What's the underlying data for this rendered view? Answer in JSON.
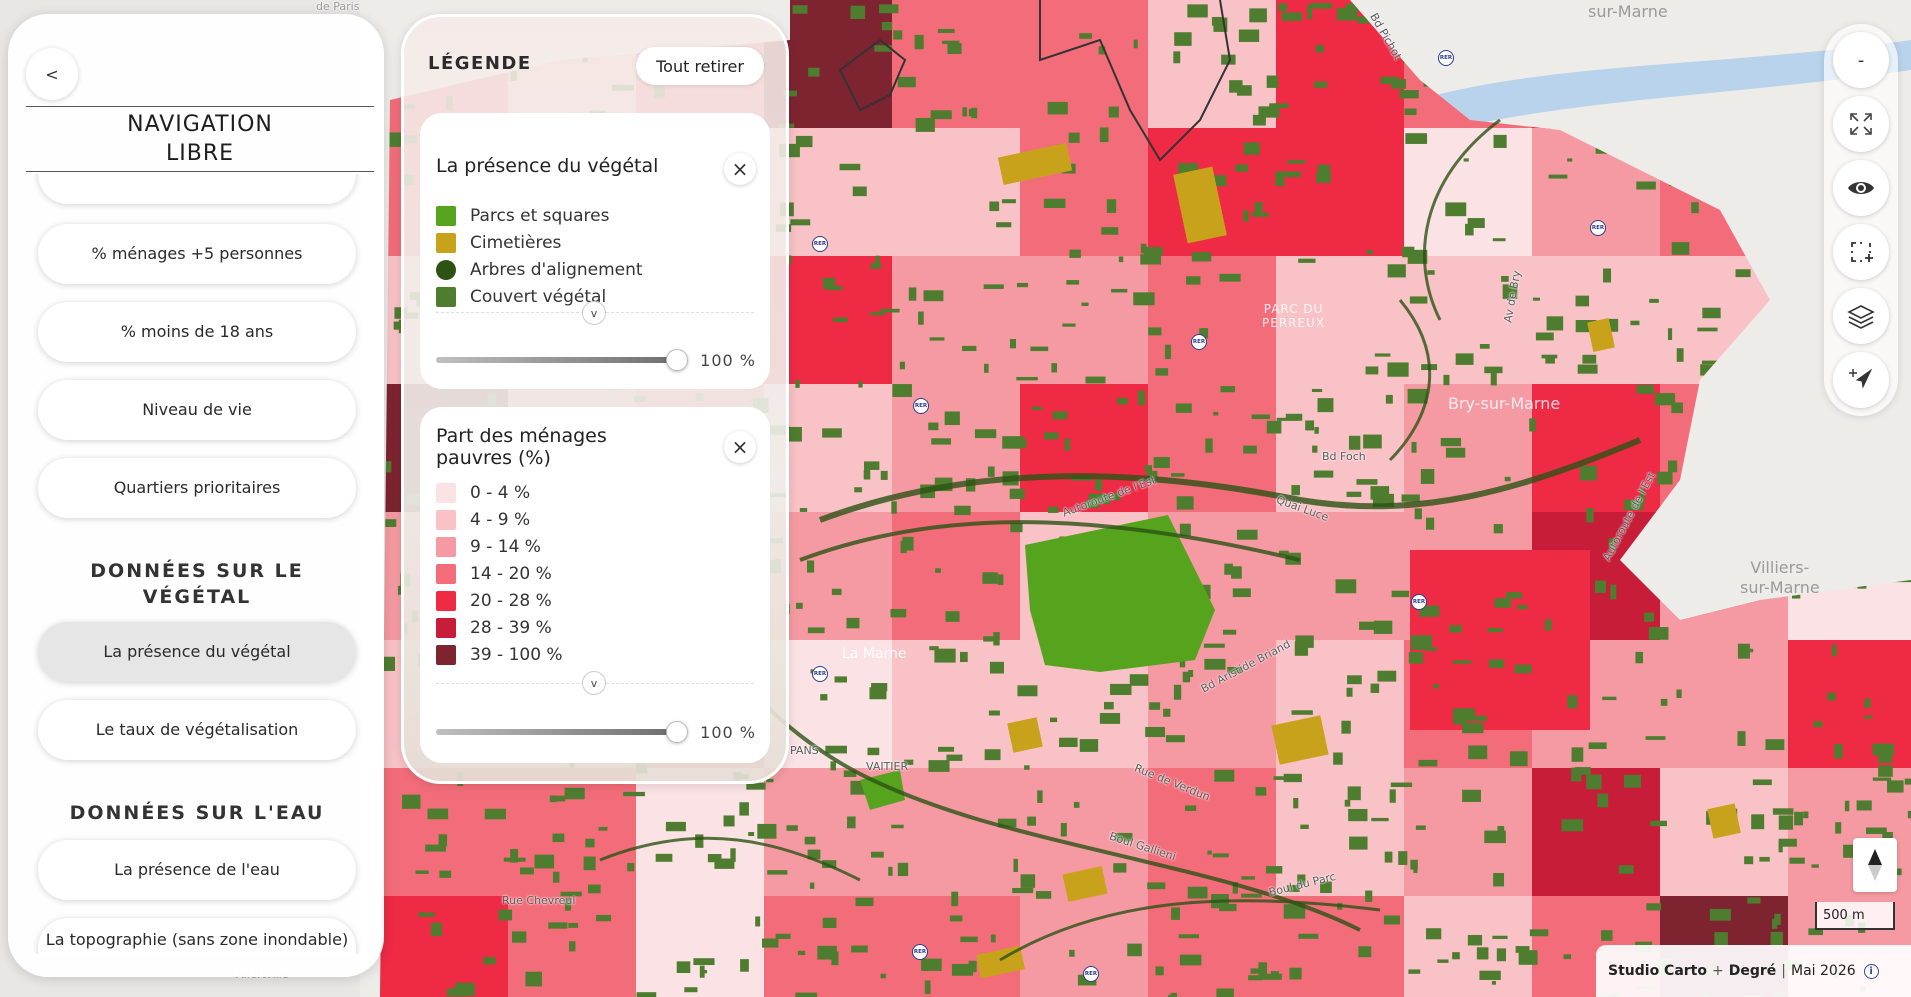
{
  "map": {
    "city_labels": [
      "sur-Marne",
      "Villiers-\nsur-Marne",
      "Bry-sur-Marne"
    ],
    "park_labels": [
      "PARC DU\nPERREUX"
    ],
    "water_labels": [
      "La Marne"
    ],
    "street_labels": [
      "Bd Foch",
      "Autoroute de l'Est",
      "Quai Luce",
      "Bd Aristide Briand",
      "Rue de Verdun",
      "Boul Gallieni",
      "Boul du Parc",
      "Rue Chevreul",
      "Autoroute de l'Est ",
      "Bd Foch ",
      "VAITIER",
      "PANS",
      "Av de Bry",
      "Bd Pichot",
      "Alfortville",
      "de Paris"
    ],
    "rer_label": "RER"
  },
  "left_panel": {
    "back_label": "<",
    "title_line1": "NAVIGATION",
    "title_line2": "LIBRE",
    "items": [
      {
        "label": "% ménages +5 personnes"
      },
      {
        "label": "% moins de 18 ans"
      },
      {
        "label": "Niveau de vie"
      },
      {
        "label": "Quartiers prioritaires"
      }
    ],
    "section_vegetal": "DONNÉES SUR LE\nVÉGÉTAL",
    "vegetal_items": [
      {
        "label": "La présence du végétal",
        "active": true
      },
      {
        "label": "Le taux de végétalisation",
        "active": false
      }
    ],
    "section_eau": "DONNÉES SUR L'EAU",
    "eau_items": [
      {
        "label": "La présence de l'eau"
      },
      {
        "label": "La topographie (sans zone inondable)"
      }
    ]
  },
  "legend": {
    "title": "LÉGENDE",
    "remove_all": "Tout retirer",
    "close_icon": "×",
    "expand_icon": "v",
    "layers": [
      {
        "title": "La présence du végétal",
        "items": [
          {
            "label": "Parcs et squares",
            "color": "#56a31e",
            "shape": "square"
          },
          {
            "label": "Cimetières",
            "color": "#c9a21c",
            "shape": "square"
          },
          {
            "label": "Arbres d'alignement",
            "color": "#2c5214",
            "shape": "circle"
          },
          {
            "label": "Couvert végétal",
            "color": "#4e7d30",
            "shape": "square"
          }
        ],
        "opacity_label": "100 %",
        "opacity": 1.0
      },
      {
        "title": "Part des ménages\npauvres (%)",
        "items": [
          {
            "label": "0 - 4 %",
            "color": "#fbe3e5"
          },
          {
            "label": "4 - 9 %",
            "color": "#f8c2c7"
          },
          {
            "label": "9 - 14 %",
            "color": "#f59aa2"
          },
          {
            "label": "14 - 20 %",
            "color": "#f26d79"
          },
          {
            "label": "20 - 28 %",
            "color": "#ee2a45"
          },
          {
            "label": "28 - 39 %",
            "color": "#c81d38"
          },
          {
            "label": "39 - 100 %",
            "color": "#7e2431"
          }
        ],
        "opacity_label": "100 %",
        "opacity": 1.0
      }
    ]
  },
  "controls": {
    "zoom_out": "-",
    "icons": [
      "minus-icon",
      "fullscreen-icon",
      "eye-icon",
      "select-area-icon",
      "layers-icon",
      "locate-icon"
    ]
  },
  "scale_label": "500 m",
  "credits": {
    "part1": "Studio Carto",
    "plus": "+",
    "part2": "Degré",
    "divider": "|",
    "date": "Mai 2026",
    "info": "i"
  }
}
